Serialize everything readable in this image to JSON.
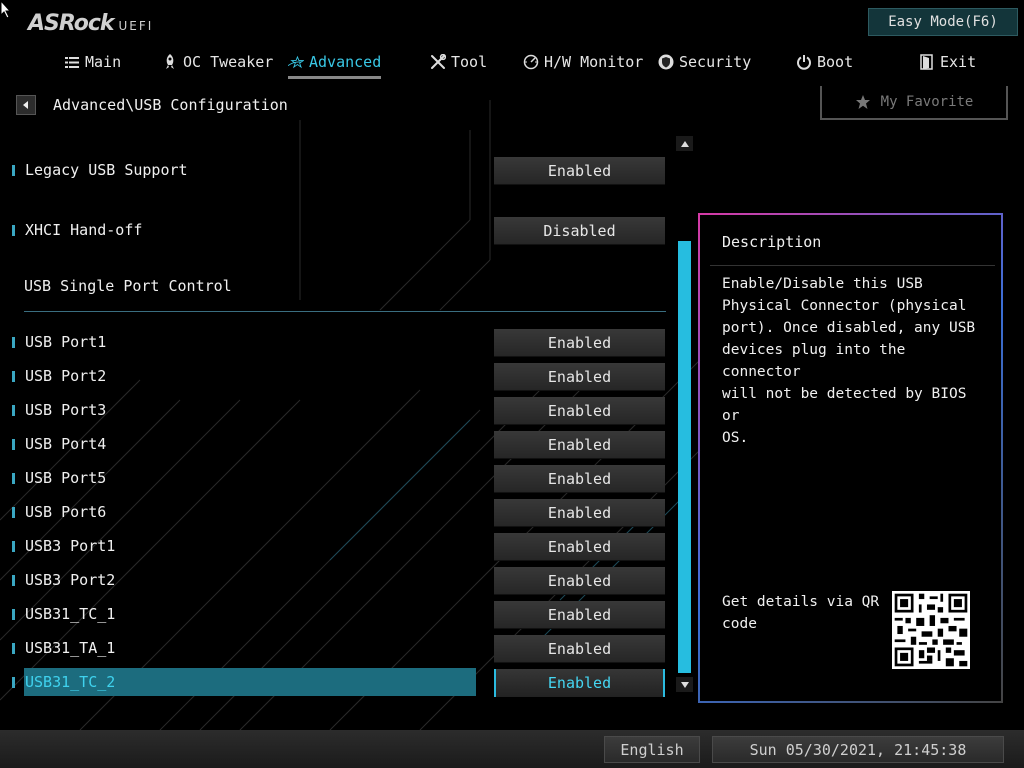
{
  "brand": {
    "name": "ASRock",
    "suffix": "UEFI"
  },
  "header": {
    "easy_mode_label": "Easy Mode(F6)"
  },
  "tabs": [
    {
      "label": "Main",
      "icon": "list-icon"
    },
    {
      "label": "OC Tweaker",
      "icon": "rocket-icon"
    },
    {
      "label": "Advanced",
      "icon": "star-icon",
      "active": true
    },
    {
      "label": "Tool",
      "icon": "tools-icon"
    },
    {
      "label": "H/W Monitor",
      "icon": "gauge-icon"
    },
    {
      "label": "Security",
      "icon": "shield-icon"
    },
    {
      "label": "Boot",
      "icon": "power-icon"
    },
    {
      "label": "Exit",
      "icon": "exit-icon"
    }
  ],
  "breadcrumb": "Advanced\\USB Configuration",
  "favorite_label": "My Favorite",
  "settings": {
    "legacy": {
      "label": "Legacy USB Support",
      "value": "Enabled"
    },
    "xhci": {
      "label": "XHCI Hand-off",
      "value": "Disabled"
    },
    "section_title": "USB Single Port Control",
    "ports": [
      {
        "label": "USB Port1",
        "value": "Enabled"
      },
      {
        "label": "USB Port2",
        "value": "Enabled"
      },
      {
        "label": "USB Port3",
        "value": "Enabled"
      },
      {
        "label": "USB Port4",
        "value": "Enabled"
      },
      {
        "label": "USB Port5",
        "value": "Enabled"
      },
      {
        "label": "USB Port6",
        "value": "Enabled"
      },
      {
        "label": "USB3 Port1",
        "value": "Enabled"
      },
      {
        "label": "USB3 Port2",
        "value": "Enabled"
      },
      {
        "label": "USB31_TC_1",
        "value": "Enabled"
      },
      {
        "label": "USB31_TA_1",
        "value": "Enabled"
      },
      {
        "label": "USB31_TC_2",
        "value": "Enabled",
        "selected": true
      }
    ]
  },
  "description": {
    "title": "Description",
    "body": "Enable/Disable this USB\nPhysical Connector (physical\nport).  Once disabled, any USB\ndevices plug into the connector\nwill not be detected by BIOS or\nOS.",
    "qr_text": "Get details via QR code"
  },
  "footer": {
    "language": "English",
    "datetime": "Sun 05/30/2021, 21:45:38"
  },
  "colors": {
    "accent": "#26bde0",
    "selected_bg": "#1c6c7e",
    "easy_mode_bg": "#13353a"
  }
}
